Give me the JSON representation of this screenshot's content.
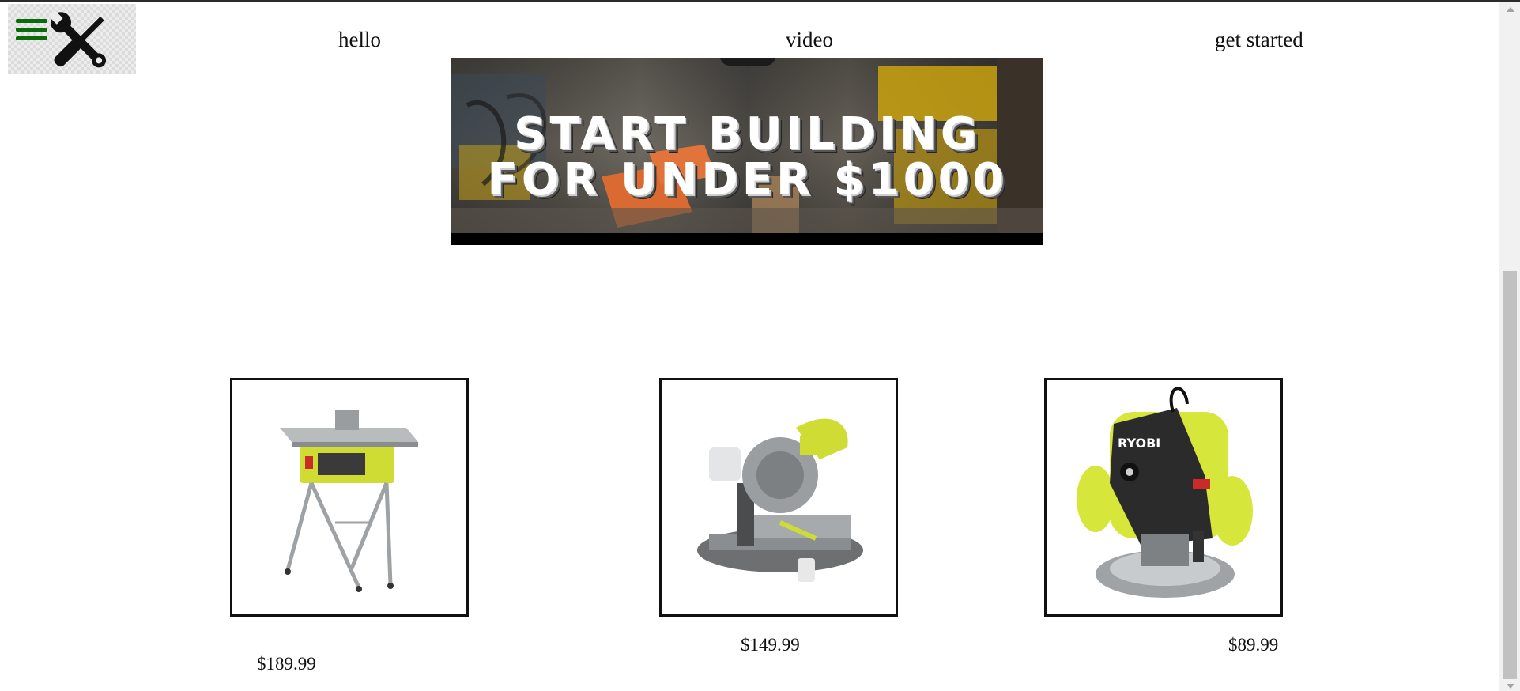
{
  "nav": {
    "links": [
      {
        "label": "hello"
      },
      {
        "label": "video"
      },
      {
        "label": "get started"
      }
    ],
    "menu_icon_color": "#0a6b0a"
  },
  "banner": {
    "line1": "START BUILDING",
    "line2": "FOR UNDER $1000"
  },
  "products": [
    {
      "icon": "table-saw",
      "price": "$189.99"
    },
    {
      "icon": "miter-saw",
      "price": "$149.99"
    },
    {
      "icon": "ryobi-router",
      "price": "$89.99",
      "brand_text": "RYOBI"
    }
  ],
  "colors": {
    "accent_green": "#0a6b0a",
    "ryobi_yellow": "#d7e63a"
  }
}
